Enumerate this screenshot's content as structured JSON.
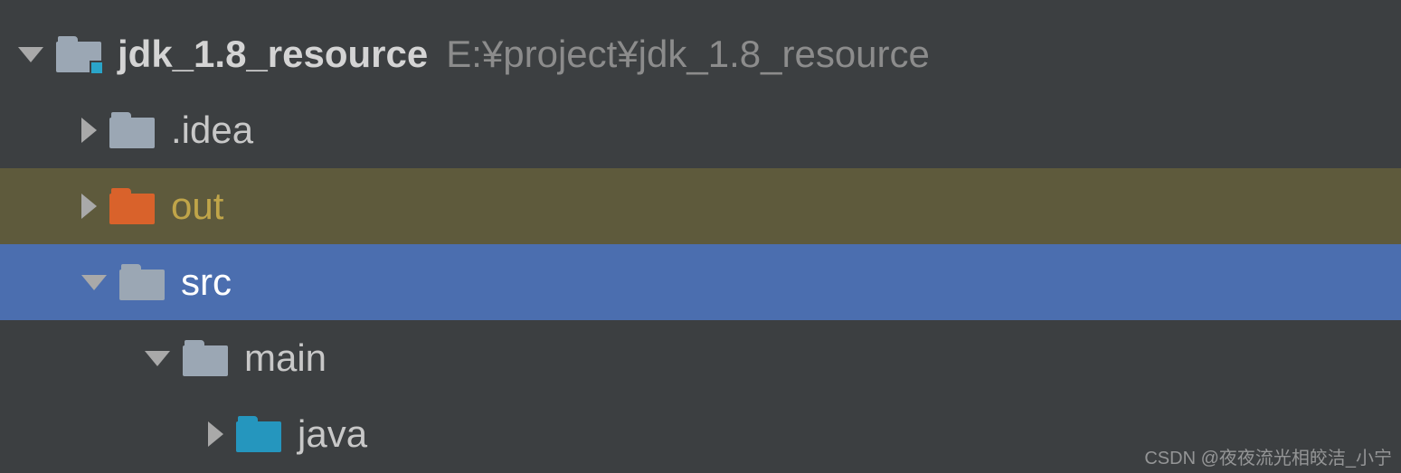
{
  "tree": {
    "root": {
      "name": "jdk_1.8_resource",
      "path": "E:¥project¥jdk_1.8_resource"
    },
    "idea": {
      "name": ".idea"
    },
    "out": {
      "name": "out"
    },
    "src": {
      "name": "src"
    },
    "main": {
      "name": "main"
    },
    "java": {
      "name": "java"
    }
  },
  "watermark": "CSDN @夜夜流光相皎洁_小宁"
}
